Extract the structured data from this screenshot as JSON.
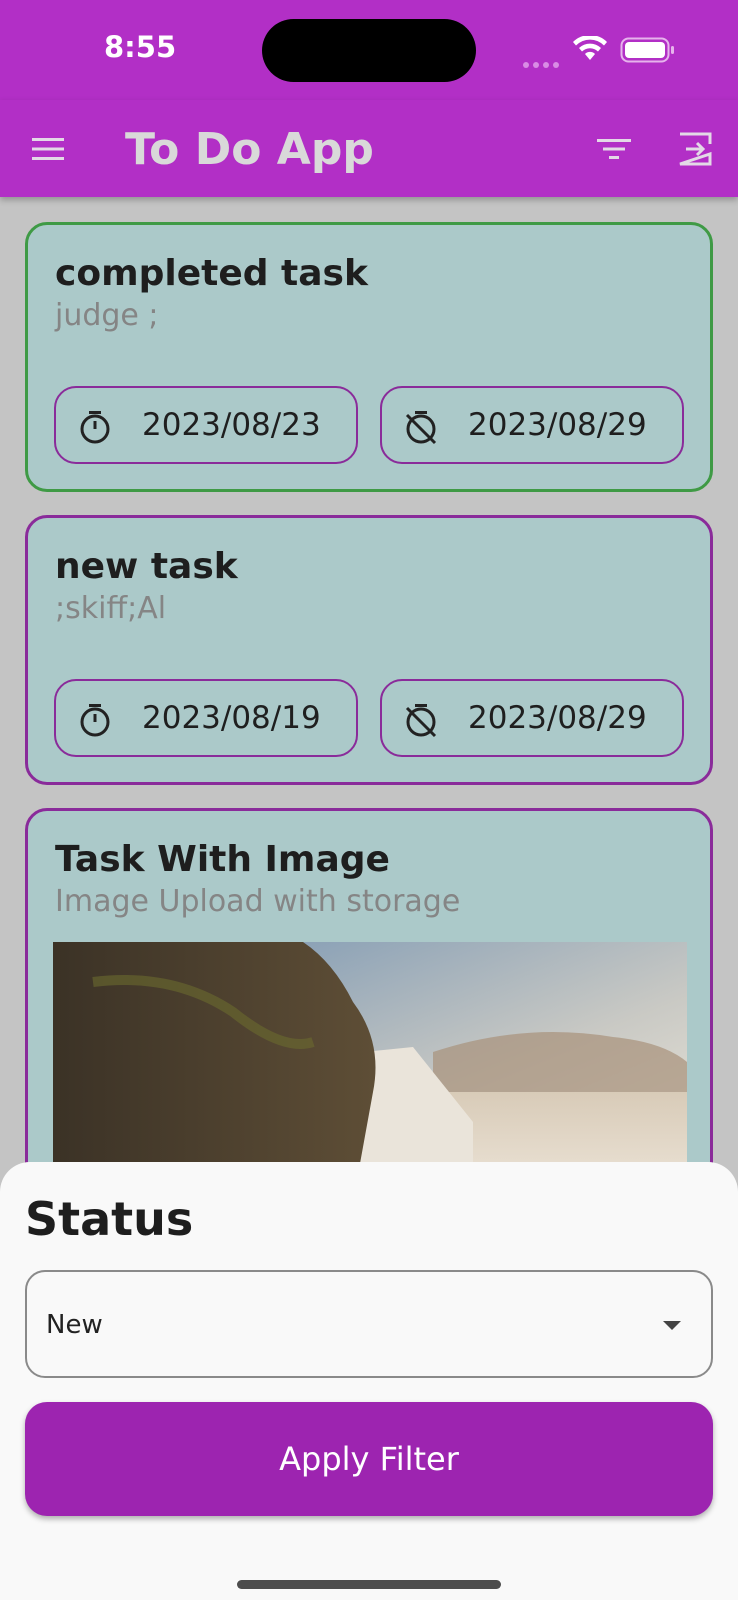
{
  "status_bar": {
    "time": "8:55"
  },
  "app_bar": {
    "title": "To Do App",
    "icons": {
      "menu": "menu-icon",
      "filter": "filter-icon",
      "logout": "logout-icon"
    }
  },
  "tasks": [
    {
      "title": "completed task",
      "description": "judge ;",
      "start_date": "2023/08/23",
      "end_date": "2023/08/29",
      "status": "completed"
    },
    {
      "title": "new task",
      "description": ";skiff;Al",
      "start_date": "2023/08/19",
      "end_date": "2023/08/29",
      "status": "new"
    },
    {
      "title": "Task With Image",
      "description": "Image Upload with storage",
      "has_image": true,
      "status": "new"
    }
  ],
  "filter_sheet": {
    "title": "Status",
    "selected_status": "New",
    "apply_label": "Apply Filter"
  },
  "colors": {
    "primary": "#b22fc6",
    "button": "#9d24b0",
    "card_bg": "#abc9c9",
    "completed_border": "#3f9a45",
    "new_border": "#8a2b9a"
  }
}
